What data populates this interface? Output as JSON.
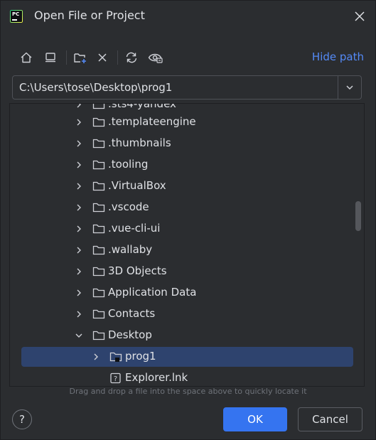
{
  "window": {
    "title": "Open File or Project"
  },
  "toolbar": {
    "icons": [
      "home-icon",
      "desktop-icon",
      "new-folder-icon",
      "delete-icon",
      "refresh-icon",
      "show-hidden-icon"
    ],
    "hide_path_label": "Hide path"
  },
  "path": {
    "value": "C:\\Users\\tose\\Desktop\\prog1"
  },
  "tree": {
    "partial_top_label": ".sts4-yandex",
    "items": [
      {
        "label": ".templateengine",
        "expanded": false
      },
      {
        "label": ".thumbnails",
        "expanded": false
      },
      {
        "label": ".tooling",
        "expanded": false
      },
      {
        "label": ".VirtualBox",
        "expanded": false
      },
      {
        "label": ".vscode",
        "expanded": false
      },
      {
        "label": ".vue-cli-ui",
        "expanded": false
      },
      {
        "label": ".wallaby",
        "expanded": false
      },
      {
        "label": "3D Objects",
        "expanded": false
      },
      {
        "label": "Application Data",
        "expanded": false
      },
      {
        "label": "Contacts",
        "expanded": false
      },
      {
        "label": "Desktop",
        "expanded": true
      },
      {
        "label": "prog1",
        "expanded": false,
        "selected": true
      },
      {
        "label": "Explorer.lnk",
        "file": true
      }
    ]
  },
  "hint": "Drag and drop a file into the space above to quickly locate it",
  "buttons": {
    "help": "?",
    "ok": "OK",
    "cancel": "Cancel"
  }
}
